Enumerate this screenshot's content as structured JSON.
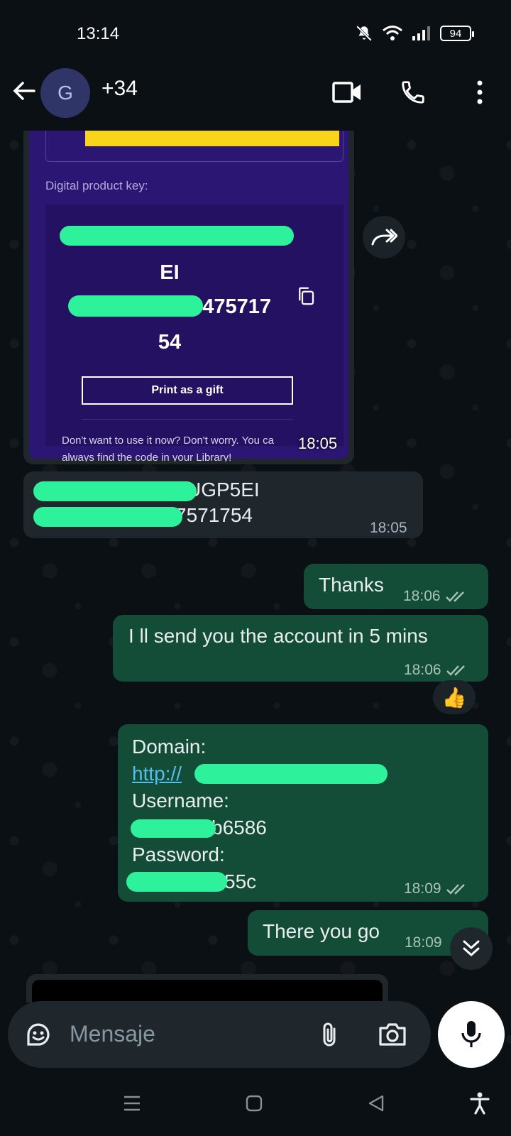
{
  "status_bar": {
    "time": "13:14",
    "battery": "94"
  },
  "header": {
    "avatar_letter": "G",
    "contact_name": "+34"
  },
  "image_message": {
    "key_label": "Digital product key:",
    "key_lines": [
      "EI",
      "475717",
      "54"
    ],
    "gift_button": "Print as a gift",
    "footer_line1": "Don't want to use it now? Don't worry. You ca",
    "footer_line2": "always find the code in your Library!",
    "time": "18:05"
  },
  "messages": [
    {
      "direction": "in",
      "lines": [
        "UGP5EI",
        "7571754"
      ],
      "time": "18:05"
    },
    {
      "direction": "out",
      "text": "Thanks",
      "time": "18:06"
    },
    {
      "direction": "out",
      "text": "I ll send you the account in 5 mins",
      "time": "18:06",
      "reaction": "👍"
    },
    {
      "direction": "out",
      "domain_label": "Domain:",
      "domain_link": "http://",
      "username_label": "Username:",
      "username_value": "b6586",
      "password_label": "Password:",
      "password_value": "55c",
      "time": "18:09"
    },
    {
      "direction": "out",
      "text": "There you go",
      "time": "18:09"
    }
  ],
  "input": {
    "placeholder": "Mensaje"
  },
  "colors": {
    "outgoing_bubble": "#134d37",
    "incoming_bubble": "#1f272d",
    "redaction": "#2ef29b",
    "key_card": "#2c1673"
  }
}
